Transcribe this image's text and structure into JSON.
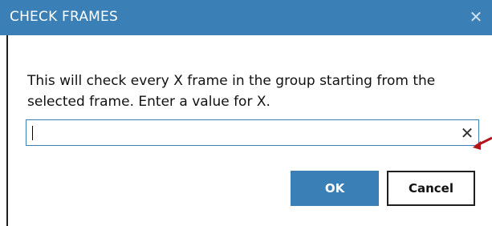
{
  "dialog": {
    "title": "CHECK FRAMES",
    "close_icon": "close-icon",
    "message": "This will check every X frame in the group starting from the selected frame. Enter a value for X.",
    "input": {
      "value": "",
      "placeholder": "",
      "clear_glyph": "✕"
    },
    "buttons": {
      "ok_label": "OK",
      "cancel_label": "Cancel"
    }
  },
  "colors": {
    "titlebar": "#3a7fb5",
    "ok_button": "#3a7fb5",
    "annotation_arrow": "#b3151b"
  }
}
